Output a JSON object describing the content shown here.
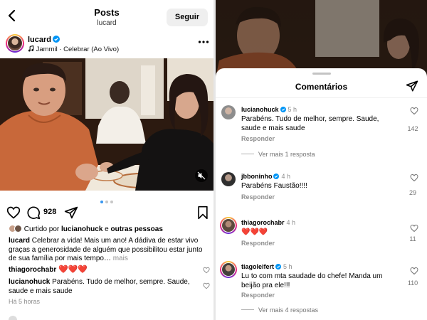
{
  "header": {
    "title": "Posts",
    "subtitle": "lucard",
    "follow_label": "Seguir"
  },
  "post": {
    "author": "lucard",
    "music": "Jammil · Celebrar (Ao Vivo)",
    "comment_count": "928",
    "carousel": {
      "total": 3,
      "active_index": 1
    },
    "liked_by_prefix": "Curtido por ",
    "liked_by_user": "lucianohuck",
    "liked_by_join": " e ",
    "liked_by_others": "outras pessoas",
    "caption_user": "lucard",
    "caption_text": " Celebrar a vida! Mais um ano! A dádiva de estar vivo graças a generosidade de alguém que possibilitou estar junto de  sua família por mais tempo…",
    "caption_more": " mais",
    "preview_comments": [
      {
        "user": "thiagorochabr",
        "text": "❤️❤️❤️"
      },
      {
        "user": "lucianohuck",
        "text": " Parabéns. Tudo de melhor, sempre. Saude, saude e mais saude"
      }
    ],
    "time_ago": "Há 5 horas"
  },
  "comments_sheet": {
    "title": "Comentários",
    "comments": [
      {
        "user": "lucianohuck",
        "time": "5 h",
        "text": "Parabéns. Tudo de melhor, sempre. Saude, saude e mais saude",
        "likes": "142",
        "reply": "Responder",
        "more": "Ver mais 1 resposta",
        "verified": true,
        "story_ring": false
      },
      {
        "user": "jbboninho",
        "time": "4 h",
        "text": "Parabéns Faustão!!!!",
        "likes": "29",
        "reply": "Responder",
        "more": "",
        "verified": true,
        "story_ring": false
      },
      {
        "user": "thiagorochabr",
        "time": "4 h",
        "text": "❤️❤️❤️",
        "likes": "11",
        "reply": "Responder",
        "more": "",
        "verified": false,
        "story_ring": true
      },
      {
        "user": "tiagoleifert",
        "time": "5 h",
        "text": "Lu to com mta saudade do chefe! Manda um beijão pra ele!!!",
        "likes": "110",
        "reply": "Responder",
        "more": "Ver mais 4 respostas",
        "verified": true,
        "story_ring": true
      }
    ]
  },
  "colors": {
    "verified_blue": "#0095f6",
    "heart_red": "#ed1f3b",
    "muted_text": "#8e8e8e",
    "button_bg": "#efefef"
  },
  "icons": {
    "back": "chevron-left-icon",
    "menu": "more-horizontal-icon",
    "music": "music-note-icon",
    "mute": "speaker-muted-icon",
    "like": "heart-outline-icon",
    "comment": "speech-bubble-icon",
    "share": "paper-plane-icon",
    "save": "bookmark-icon"
  }
}
